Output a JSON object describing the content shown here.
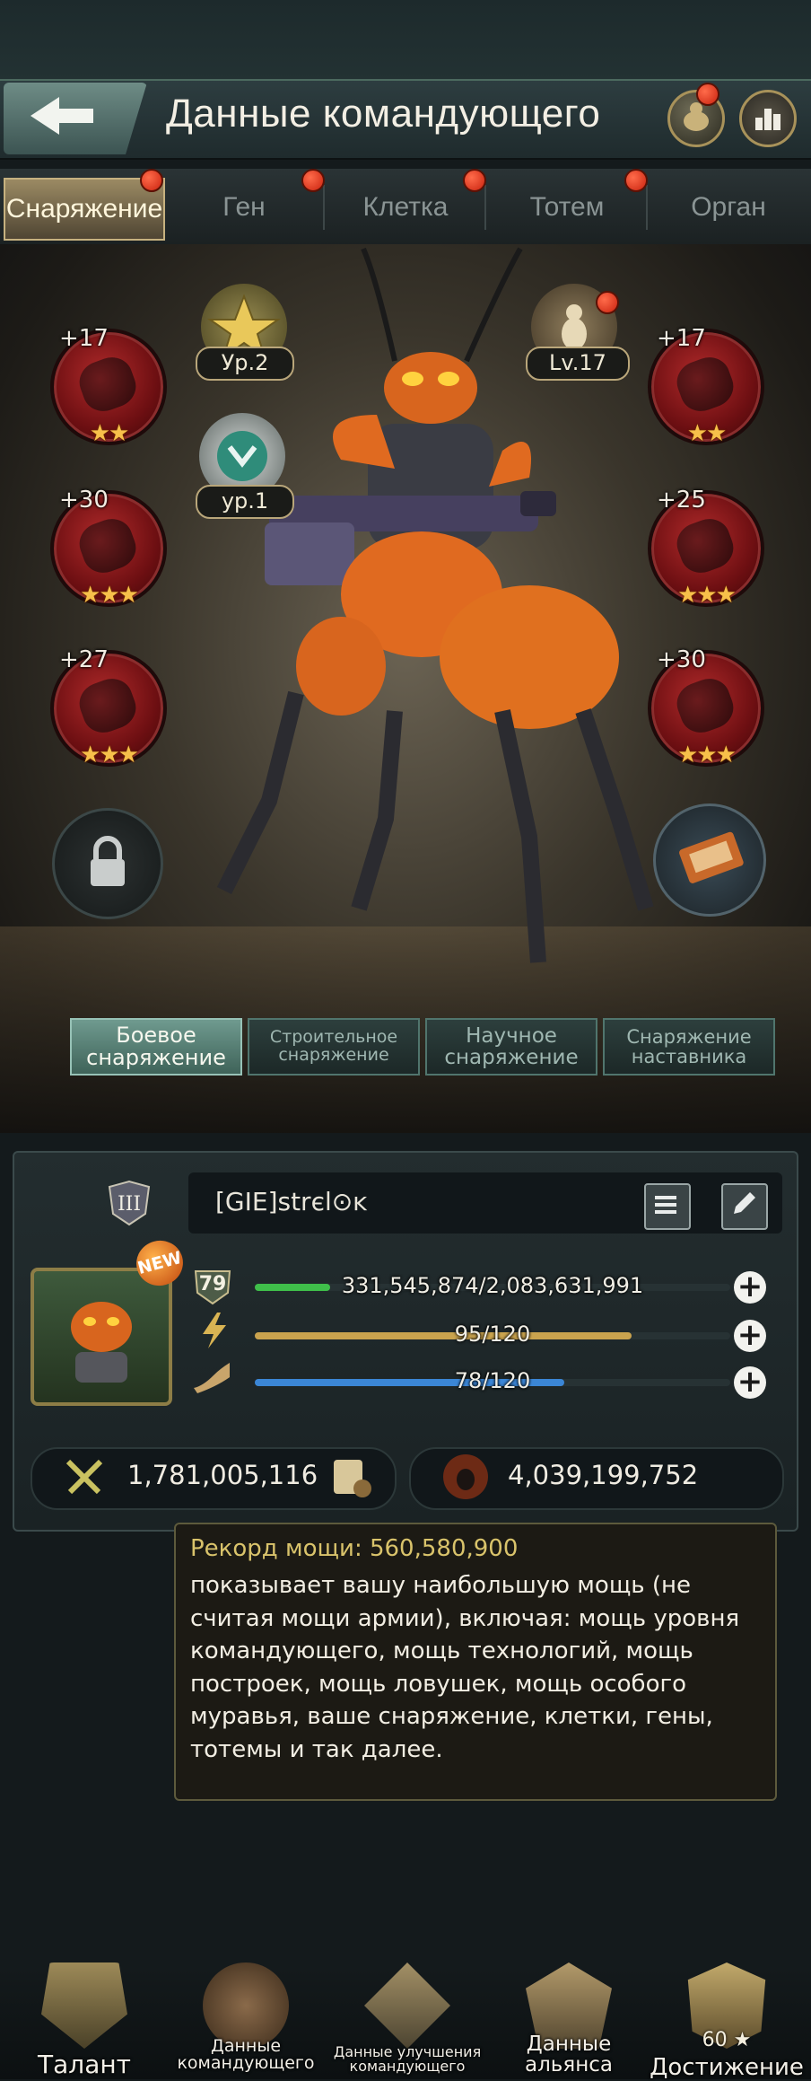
{
  "header": {
    "title": "Данные командующего"
  },
  "tabs": [
    {
      "label": "Снаряжение",
      "active": true
    },
    {
      "label": "Ген"
    },
    {
      "label": "Клетка"
    },
    {
      "label": "Тотем"
    },
    {
      "label": "Орган"
    }
  ],
  "badges": {
    "medal_gold": "Ур.2",
    "medal_silver": "ур.1",
    "medal_ant": "Lv.17"
  },
  "equipment_left": [
    {
      "bonus": "+17",
      "stars": "★★"
    },
    {
      "bonus": "+30",
      "stars": "★★★"
    },
    {
      "bonus": "+27",
      "stars": "★★★"
    }
  ],
  "equipment_right": [
    {
      "bonus": "+17",
      "stars": "★★"
    },
    {
      "bonus": "+25",
      "stars": "★★★"
    },
    {
      "bonus": "+30",
      "stars": "★★★"
    }
  ],
  "gear_tabs": [
    {
      "label": "Боевое снаряжение",
      "active": true
    },
    {
      "label": "Строительное снаряжение"
    },
    {
      "label": "Научное снаряжение"
    },
    {
      "label": "Снаряжение наставника"
    }
  ],
  "profile": {
    "name": "[GIE]ꜱtrєl⊙ĸ",
    "level": "79",
    "new_badge": "NEW",
    "bars": [
      {
        "text": "331,545,874/2,083,631,991",
        "fill": 0.159,
        "color": "#3fbf4a"
      },
      {
        "text": "95/120",
        "fill": 0.792,
        "color": "#c9a34e"
      },
      {
        "text": "78/120",
        "fill": 0.65,
        "color": "#3b86d6"
      }
    ],
    "power": "1,781,005,116",
    "kills": "4,039,199,752"
  },
  "tooltip": {
    "title": "Рекорд мощи: 560,580,900",
    "body": "показывает вашу наибольшую мощь (не считая мощи армии), включая: мощь уровня командующего, мощь технологий, мощь построек, мощь ловушек, мощь особого муравья, ваше снаряжение, клетки, гены, тотемы и так далее."
  },
  "bottom_nav": [
    {
      "label": "Талант"
    },
    {
      "label": "Данные командующего"
    },
    {
      "label": "Данные улучшения командующего"
    },
    {
      "label": "Данные альянса"
    },
    {
      "label": "Достижение",
      "count": "60 ★"
    }
  ],
  "colors": {
    "accent_red": "#c9230f",
    "gold": "#d9c36b",
    "teal": "#6f9a8f"
  }
}
